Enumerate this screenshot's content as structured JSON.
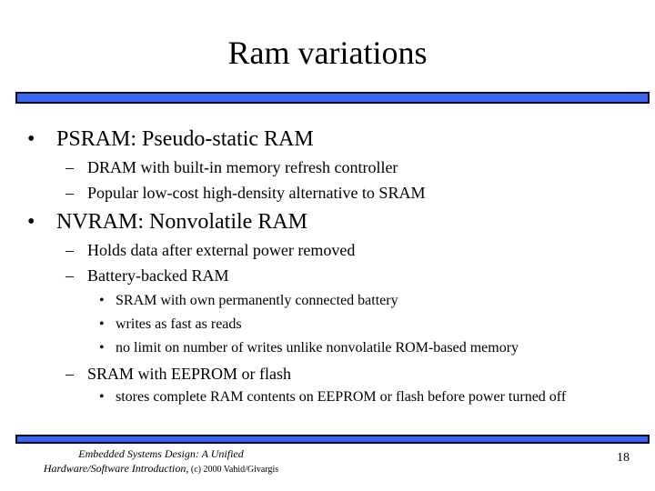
{
  "slide": {
    "title": "Ram variations",
    "accent_color": "#3a66f0",
    "bullets": [
      {
        "text": "PSRAM: Pseudo-static RAM",
        "children": [
          {
            "text": "DRAM with built-in memory refresh controller"
          },
          {
            "text": "Popular low-cost high-density alternative to SRAM"
          }
        ]
      },
      {
        "text": "NVRAM: Nonvolatile RAM",
        "children": [
          {
            "text": "Holds data after external power removed"
          },
          {
            "text": "Battery-backed RAM",
            "children": [
              {
                "text": "SRAM with own permanently connected battery"
              },
              {
                "text": "writes as fast as reads"
              },
              {
                "text": "no limit on number of writes unlike nonvolatile ROM-based memory"
              }
            ]
          },
          {
            "text": "SRAM with EEPROM or flash",
            "children": [
              {
                "text": "stores complete RAM contents on EEPROM or flash before power turned off"
              }
            ]
          }
        ]
      }
    ],
    "markers": {
      "level1": "•",
      "level2": "–",
      "level3": "•"
    }
  },
  "footer": {
    "line1": "Embedded Systems Design: A Unified",
    "line2_italic": "Hardware/Software Introduction,",
    "line2_normal": " (c) 2000 Vahid/Givargis",
    "page_number": "18"
  }
}
